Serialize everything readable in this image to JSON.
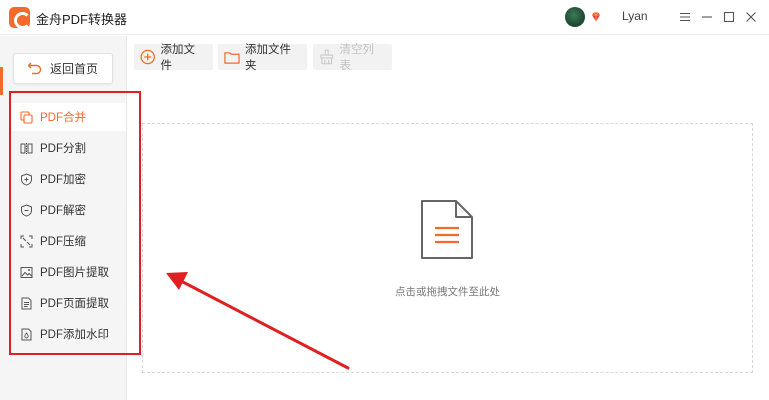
{
  "titlebar": {
    "app_title": "金舟PDF转换器",
    "username": "Lyan"
  },
  "sidebar": {
    "back_label": "返回首页",
    "items": [
      {
        "label": "PDF合并",
        "icon": "merge-icon",
        "active": true
      },
      {
        "label": "PDF分割",
        "icon": "split-icon",
        "active": false
      },
      {
        "label": "PDF加密",
        "icon": "lock-shield-icon",
        "active": false
      },
      {
        "label": "PDF解密",
        "icon": "unlock-shield-icon",
        "active": false
      },
      {
        "label": "PDF压缩",
        "icon": "compress-icon",
        "active": false
      },
      {
        "label": "PDF图片提取",
        "icon": "image-extract-icon",
        "active": false
      },
      {
        "label": "PDF页面提取",
        "icon": "page-extract-icon",
        "active": false
      },
      {
        "label": "PDF添加水印",
        "icon": "watermark-icon",
        "active": false
      }
    ]
  },
  "toolbar": {
    "add_file": "添加文件",
    "add_folder": "添加文件夹",
    "clear_list": "清空列表"
  },
  "dropzone": {
    "hint": "点击或拖拽文件至此处"
  },
  "colors": {
    "accent": "#f36a2a",
    "annotation": "#e02020"
  }
}
